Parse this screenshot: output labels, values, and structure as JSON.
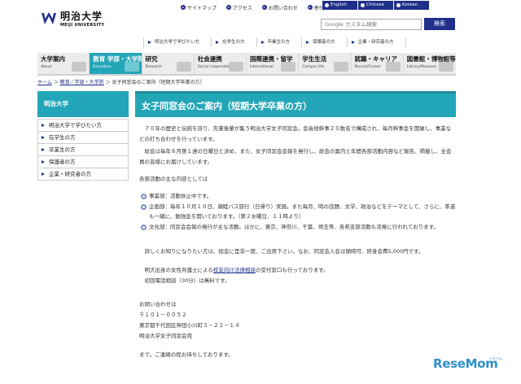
{
  "header": {
    "logo_jp": "明治大学",
    "logo_en": "MEIJI UNIVERSITY",
    "top_links": [
      {
        "label": "サイトマップ",
        "icon": "sitemap-icon"
      },
      {
        "label": "アクセス",
        "icon": "access-icon"
      },
      {
        "label": "お問い合わせ",
        "icon": "contact-icon"
      },
      {
        "label": "寄付",
        "icon": "donation-icon"
      }
    ],
    "languages": [
      "English",
      "Chinese",
      "Korean"
    ],
    "search_placeholder": "Google カスタム検索",
    "search_button": "検索",
    "sub_nav": [
      "明治大学で学びたい方",
      "在学生の方",
      "卒業生の方",
      "保護者の方",
      "企業・研究者の方"
    ]
  },
  "global_nav": [
    {
      "jp": "大学案内",
      "en": "About"
    },
    {
      "jp": "教育 学部・大学院",
      "en": "Education"
    },
    {
      "jp": "研究",
      "en": "Research"
    },
    {
      "jp": "社会連携",
      "en": "Social cooperation"
    },
    {
      "jp": "国際連携・留学",
      "en": "International"
    },
    {
      "jp": "学生生活",
      "en": "Campus life"
    },
    {
      "jp": "就職・キャリア",
      "en": "Recruit/Career"
    },
    {
      "jp": "図書館・博物館等",
      "en": "Library/Museum"
    }
  ],
  "breadcrumb": {
    "home": "ホーム",
    "sep": " ＞ ",
    "section": "教育／学部・大学院",
    "current": "女子同窓会のご案内（短期大学卒業の方）"
  },
  "sidebar": {
    "title": "明治大学",
    "items": [
      "明治大学で学びたい方",
      "在学生の方",
      "卒業生の方",
      "保護者の方",
      "企業・研究者の方"
    ]
  },
  "main": {
    "title": "女子同窓会のご案内（短期大学卒業の方）",
    "intro": "　７０年の歴史と伝統を誇り、先輩後輩が集う明治大学女子同窓会。会長他幹事２０数名で構成され、毎月幹事会を開催し、事業などの打ち合わせを行っています。",
    "intro2": "　総会は毎年６月第１週の日曜日と決め、また、女子同窓会会報を発行し、総会の案内と年間各部活動内容など報告、掲載し、全会員の皆様にお届けしています。",
    "activities_heading": "各部活動の主な内容としては",
    "activities": [
      "事業部：活動休止中です。",
      "企画部：毎年１０月１０日、親睦バス旅行（日帰り）実施。また毎月、時の話題、文学、政治などをテーマとして、さらに、茶道も一緒に、勉強会を開いております。（第２水曜日、１１時より）",
      "文化部：同窓会会報の発行が主な活動。ほかに、東京、神奈川、千葉、埼玉等、各県支部活動も活発に行われております。"
    ],
    "info": "　詳しくお知りになりたい方は、総会に是非一度、ご出席下さい。なお、同窓会入会は随時可、終身会費5,000円です。",
    "legal_before": "　明大出身の女性弁護士による",
    "legal_link": "校友向け法律相談",
    "legal_after": "の受付窓口も行っております。",
    "legal_note": "　初回電話相談（30分）は無料です。",
    "contact_heading": "お問い合わせは",
    "postal": "〒１０１－００５２",
    "address": "東京都千代田区神田小川町３－２２－１４",
    "org": "明治大学女子同窓会宛",
    "closing": "まで。ご連絡の程お待ちしております。"
  },
  "watermark": {
    "text": "ReseMom",
    "sub": "リセマム"
  }
}
